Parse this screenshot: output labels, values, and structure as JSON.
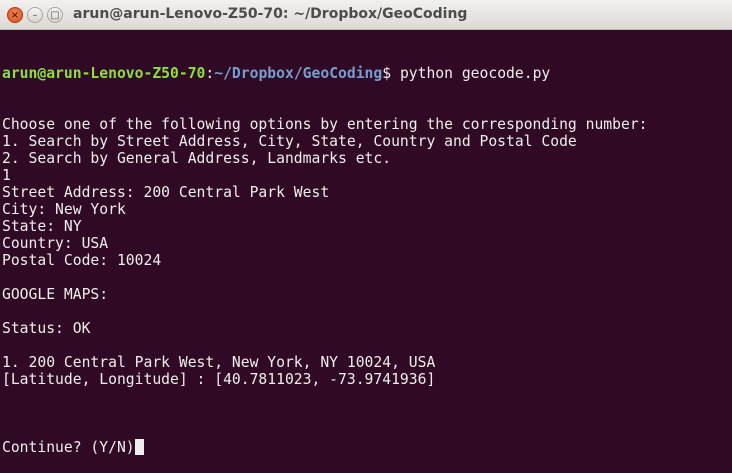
{
  "window": {
    "title": "arun@arun-Lenovo-Z50-70: ~/Dropbox/GeoCoding"
  },
  "prompt": {
    "user": "arun@arun-Lenovo-Z50-70",
    "sep": ":",
    "path": "~/Dropbox/GeoCoding",
    "symbol": "$ ",
    "command": "python geocode.py"
  },
  "output": [
    "Choose one of the following options by entering the corresponding number:",
    "1. Search by Street Address, City, State, Country and Postal Code",
    "2. Search by General Address, Landmarks etc.",
    "1",
    "Street Address: 200 Central Park West",
    "City: New York",
    "State: NY",
    "Country: USA",
    "Postal Code: 10024",
    "",
    "GOOGLE MAPS:",
    "",
    "Status: OK",
    "",
    "1. 200 Central Park West, New York, NY 10024, USA",
    "[Latitude, Longitude] : [40.7811023, -73.9741936]",
    ""
  ],
  "last_line": "Continue? (Y/N)",
  "colors": {
    "background": "#300a24",
    "user": "#8ae234",
    "path": "#729fcf",
    "text": "#eeeeec"
  }
}
